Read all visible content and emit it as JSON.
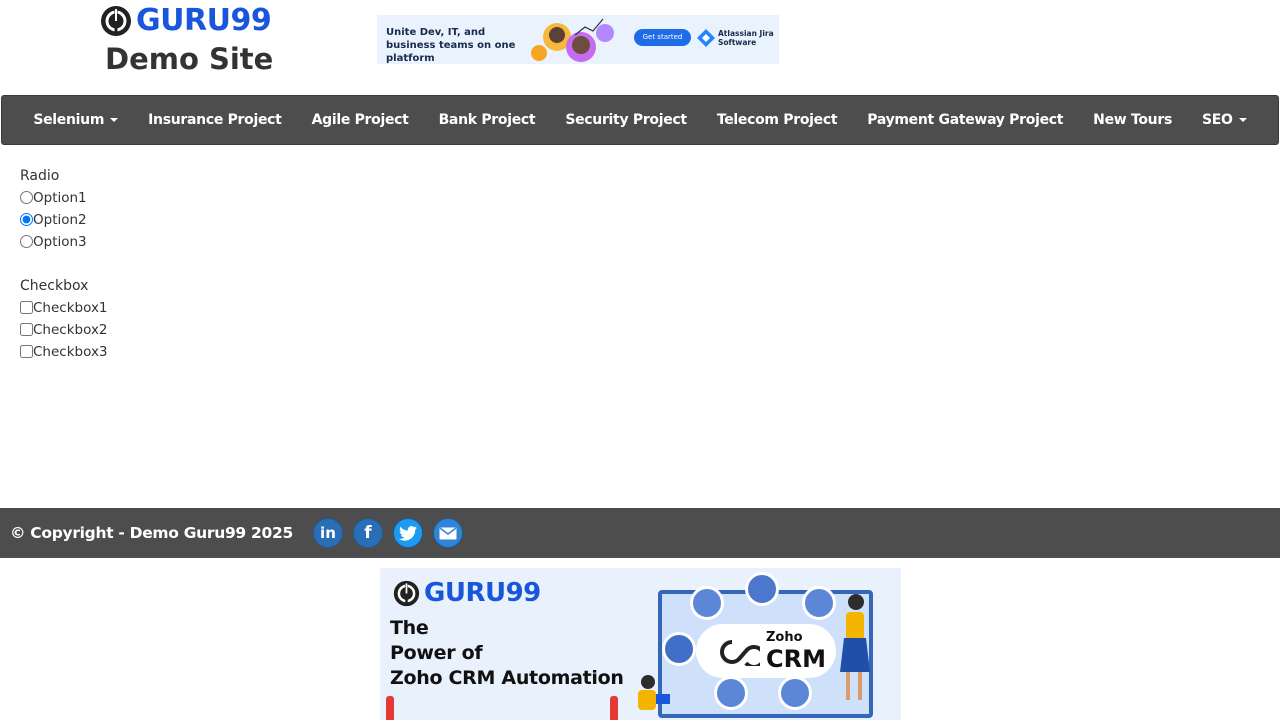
{
  "header": {
    "logo_brand": "GURU99",
    "logo_subtitle": "Demo Site",
    "top_ad": {
      "text": "Unite Dev, IT, and business teams on one platform",
      "button": "Get started",
      "brand": "Atlassian Jira Software"
    }
  },
  "nav": {
    "items": [
      {
        "label": "Selenium",
        "dropdown": true
      },
      {
        "label": "Insurance Project"
      },
      {
        "label": "Agile Project"
      },
      {
        "label": "Bank Project"
      },
      {
        "label": "Security Project"
      },
      {
        "label": "Telecom Project"
      },
      {
        "label": "Payment Gateway Project"
      },
      {
        "label": "New Tours"
      },
      {
        "label": "SEO",
        "dropdown": true
      }
    ]
  },
  "form": {
    "radio_label": "Radio",
    "radios": [
      {
        "label": "Option1",
        "checked": false
      },
      {
        "label": "Option2",
        "checked": true
      },
      {
        "label": "Option3",
        "checked": false
      }
    ],
    "checkbox_label": "Checkbox",
    "checkboxes": [
      {
        "label": "Checkbox1",
        "checked": false
      },
      {
        "label": "Checkbox2",
        "checked": false
      },
      {
        "label": "Checkbox3",
        "checked": false
      }
    ]
  },
  "footer": {
    "copyright": "© Copyright - Demo Guru99 2025",
    "social": [
      "linkedin-icon",
      "facebook-icon",
      "twitter-icon",
      "email-icon"
    ]
  },
  "bottom_ad": {
    "brand": "GURU99",
    "headline_1": "The",
    "headline_2": "Power of",
    "headline_3": "Zoho CRM Automation",
    "product_1": "Zoho",
    "product_2": "CRM"
  },
  "colors": {
    "nav_bg": "#4d4d4d",
    "brand_blue": "#1a56db",
    "text": "#333333"
  }
}
